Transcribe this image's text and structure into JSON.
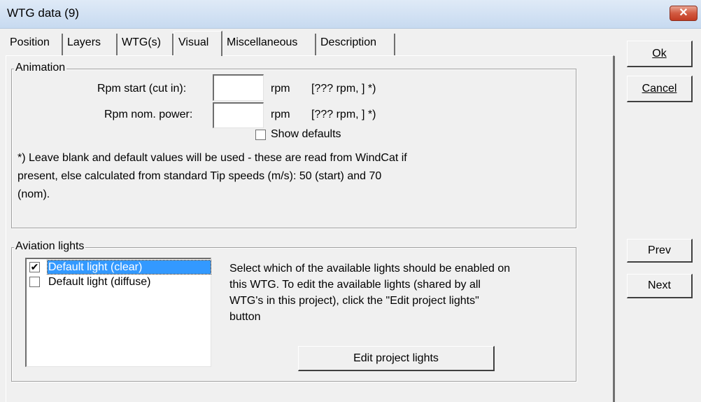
{
  "window": {
    "title": "WTG data  (9)",
    "close_label": "✕"
  },
  "tabs": [
    {
      "label": "Position",
      "active": false
    },
    {
      "label": "Layers",
      "active": false
    },
    {
      "label": "WTG(s)",
      "active": false
    },
    {
      "label": "Visual",
      "active": true
    },
    {
      "label": "Miscellaneous",
      "active": false
    },
    {
      "label": "Description",
      "active": false
    }
  ],
  "animation": {
    "legend": "Animation",
    "rpm_start_label": "Rpm start (cut in):",
    "rpm_start_value": "",
    "rpm_start_unit": "rpm",
    "rpm_start_default": "[??? rpm, ] *)",
    "rpm_nom_label": "Rpm nom. power:",
    "rpm_nom_value": "",
    "rpm_nom_unit": "rpm",
    "rpm_nom_default": "[??? rpm, ] *)",
    "show_defaults_label": "Show defaults",
    "show_defaults_checked": false,
    "note_line1": "*) Leave blank and default values will be used - these are read from WindCat if",
    "note_line2": "present, else calculated from standard Tip speeds (m/s): 50 (start) and 70",
    "note_line3": "(nom)."
  },
  "aviation": {
    "legend": "Aviation lights",
    "lights": [
      {
        "label": "Default light (clear)",
        "checked": true,
        "selected": true
      },
      {
        "label": "Default light (diffuse)",
        "checked": false,
        "selected": false
      }
    ],
    "desc_line1": "Select which of the available lights should be enabled on",
    "desc_line2": "this WTG. To edit the available lights (shared by all",
    "desc_line3": "WTG's in this project), click the \"Edit project lights\"",
    "desc_line4": "button",
    "edit_button": "Edit project lights"
  },
  "buttons": {
    "ok": "Ok",
    "cancel": "Cancel",
    "prev": "Prev",
    "next": "Next"
  },
  "check_mark": "✔"
}
